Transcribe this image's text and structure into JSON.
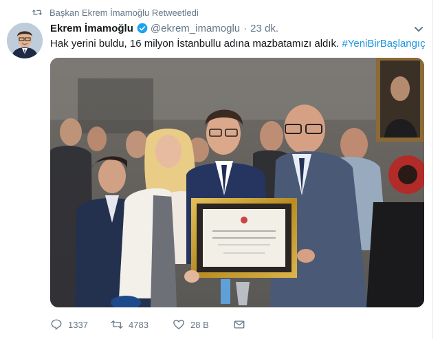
{
  "retweet": {
    "text": "Başkan Ekrem İmamoğlu Retweetledi",
    "icon": "retweet-icon"
  },
  "tweet": {
    "author_name": "Ekrem İmamoğlu",
    "handle": "@ekrem_imamoglu",
    "separator": "·",
    "time": "23 dk.",
    "verified_icon": "verified-badge-icon",
    "menu_icon": "chevron-down-icon",
    "text": "Hak yerini buldu, 16 milyon İstanbullu adına mazbatamızı aldık.",
    "hashtag": "#YeniBirBaşlangıç"
  },
  "actions": {
    "replies": "1337",
    "retweets": "4783",
    "likes": "28 B",
    "reply_icon": "reply-icon",
    "retweet_icon": "retweet-icon",
    "like_icon": "heart-icon",
    "dm_icon": "envelope-icon"
  },
  "colors": {
    "link": "#1b95e0",
    "meta": "#657786",
    "text": "#14171a",
    "verified": "#1da1f2",
    "certificate_frame": "#c9a227"
  }
}
